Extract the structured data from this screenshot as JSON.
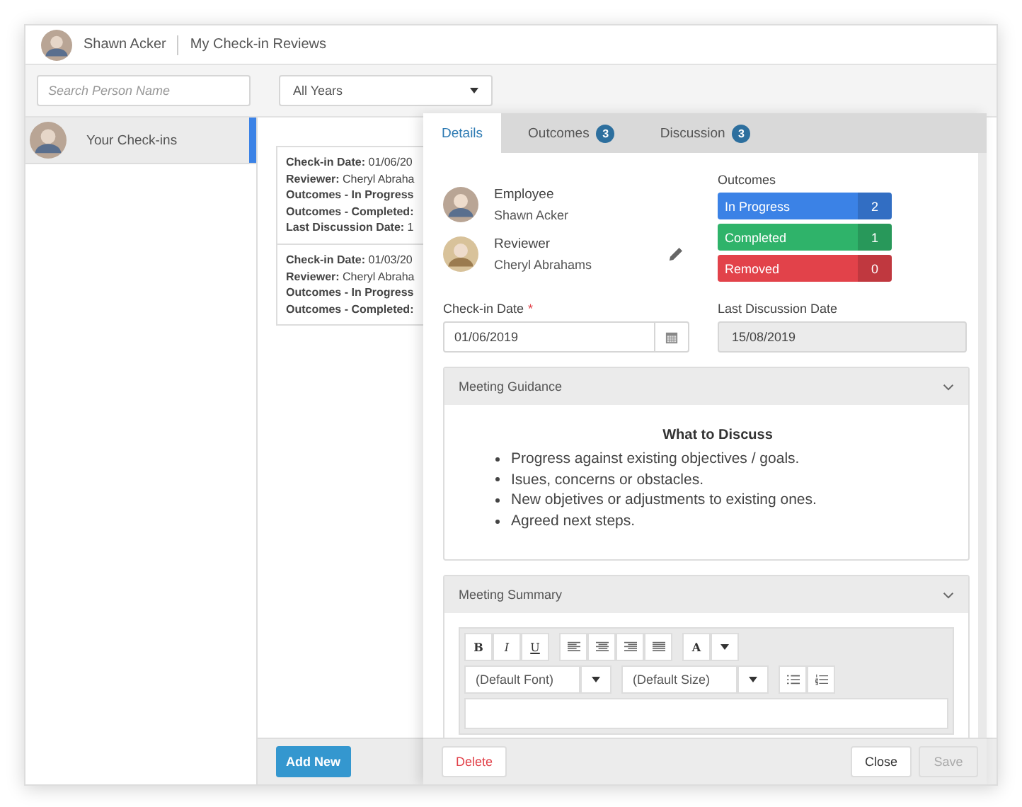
{
  "header": {
    "user_name": "Shawn Acker",
    "title": "My Check-in Reviews"
  },
  "filters": {
    "search": {
      "placeholder": "Search Person Name"
    },
    "year": {
      "value": "All Years"
    }
  },
  "sidebar": {
    "items": [
      {
        "label": "Your Check-ins",
        "selected": true
      }
    ]
  },
  "checkins": [
    {
      "lines": [
        "**Check-in Date:** 01/06/20",
        "**Reviewer:** Cheryl Abraha",
        "**Outcomes - In Progress**",
        "**Outcomes - Completed:**",
        "**Last Discussion Date:** 1"
      ]
    },
    {
      "lines": [
        "**Check-in Date:** 01/03/20",
        "**Reviewer:** Cheryl Abraha",
        "**Outcomes - In Progress**",
        "**Outcomes - Completed:**"
      ]
    }
  ],
  "add_button": "Add New",
  "panel": {
    "tabs": [
      {
        "label": "Details",
        "selected": true
      },
      {
        "label": "Outcomes",
        "badge": "3",
        "selected": false
      },
      {
        "label": "Discussion",
        "badge": "3",
        "selected": false
      }
    ],
    "people": [
      {
        "role": "Employee",
        "name": "Shawn Acker",
        "editable": false
      },
      {
        "role": "Reviewer",
        "name": "Cheryl Abrahams",
        "editable": true
      }
    ],
    "outcomes": {
      "title": "Outcomes",
      "items": [
        {
          "label": "In Progress",
          "count": "2",
          "color": "#3b82e6"
        },
        {
          "label": "Completed",
          "count": "1",
          "color": "#2fb36a"
        },
        {
          "label": "Removed",
          "count": "0",
          "color": "#e2424a"
        }
      ]
    },
    "checkin_date": {
      "label": "Check-in Date",
      "required_mark": "*",
      "value": "01/06/2019"
    },
    "last_discussion": {
      "label": "Last Discussion Date",
      "value": "15/08/2019",
      "disabled": true
    },
    "guidance": {
      "title": "Meeting Guidance",
      "expanded": true,
      "heading": "What to Discuss",
      "bullets": [
        "Progress against existing objectives / goals.",
        "Isues, concerns or obstacles.",
        "New objetives or adjustments to existing ones.",
        "Agreed next steps."
      ]
    },
    "summary": {
      "title": "Meeting Summary",
      "expanded": true,
      "format_buttons": [
        "B",
        "I",
        "U"
      ],
      "color_button": "A",
      "font": "(Default Font)",
      "size": "(Default Size)"
    },
    "footer": {
      "delete": "Delete",
      "close": "Close",
      "save": {
        "label": "Save",
        "disabled": true
      }
    }
  }
}
